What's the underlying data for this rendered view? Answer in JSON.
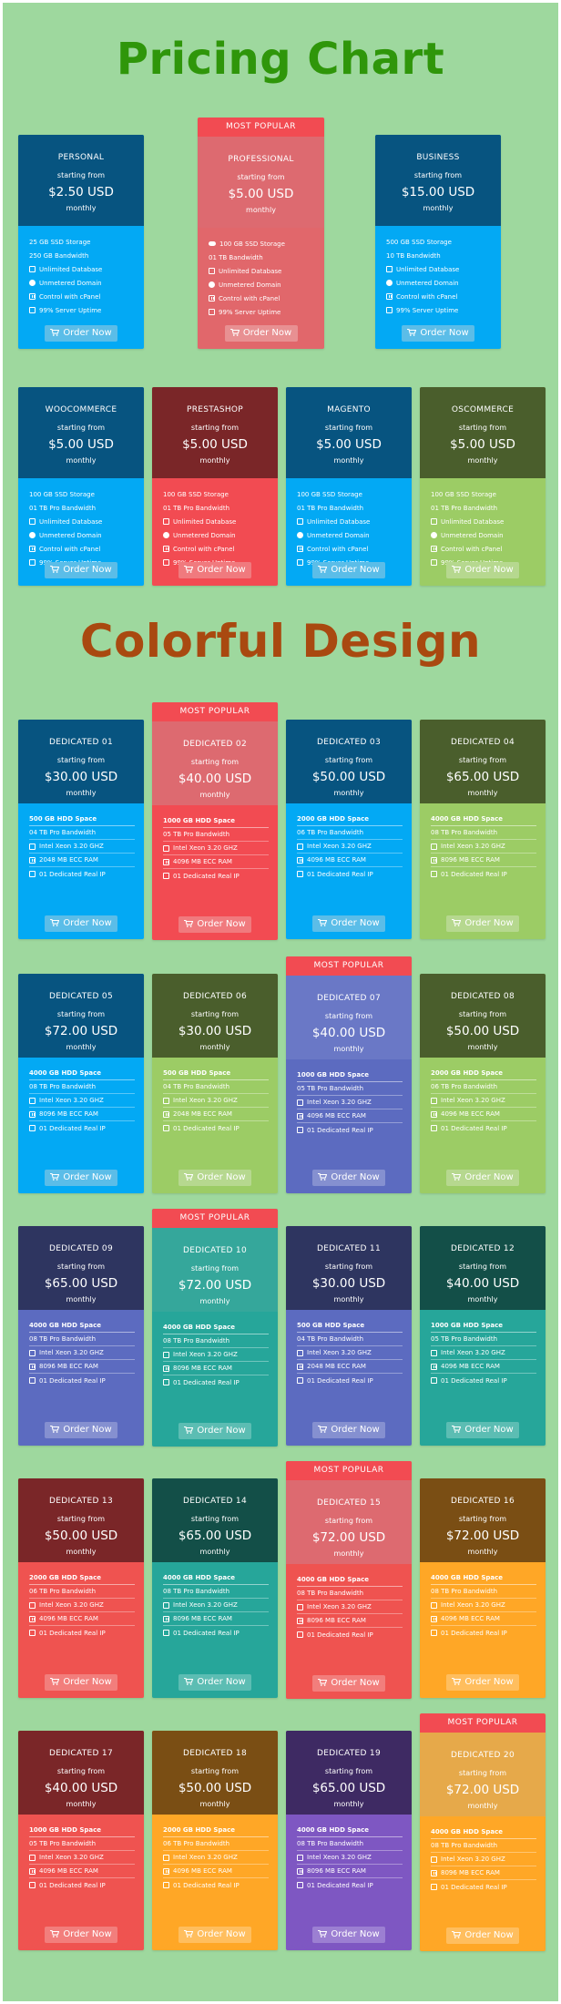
{
  "titles": {
    "pricing_chart": "Pricing Chart",
    "colorful_design": "Colorful Design"
  },
  "colors": {
    "page_bg": "#9ed89e",
    "title_green": "#2f960a",
    "title_orange": "#a94910",
    "most_popular_red": "#f24b52"
  },
  "common": {
    "starting_from": "starting from",
    "monthly": "monthly",
    "order_label": "Order Now",
    "most_popular": "MOST POPULAR"
  },
  "cards": [
    {
      "id": "personal",
      "name": "PERSONAL",
      "price": "$2.50 USD",
      "popular": false,
      "top_color": "#075480",
      "bottom_color": "#03a9f4",
      "button_color": "#5bbde8",
      "features": [
        {
          "icon": "none",
          "text": "25 GB SSD Storage"
        },
        {
          "icon": "none",
          "text": "250 GB Bandwidth"
        },
        {
          "icon": "database-icon",
          "text": "Unlimited Database"
        },
        {
          "icon": "globe-icon",
          "text": "Unmetered Domain"
        },
        {
          "icon": "cpanel-icon",
          "text": "Control with cPanel"
        },
        {
          "icon": "check-icon",
          "text": "99% Server Uptime"
        }
      ]
    },
    {
      "id": "professional",
      "name": "PROFESSIONAL",
      "price": "$5.00 USD",
      "popular": true,
      "top_color": "#dd6a70",
      "bottom_color": "#e1676b",
      "button_color": "#e89092",
      "features": [
        {
          "icon": "cloud-icon",
          "text": "100 GB SSD Storage"
        },
        {
          "icon": "none",
          "text": "01 TB Bandwidth"
        },
        {
          "icon": "database-icon",
          "text": "Unlimited Database"
        },
        {
          "icon": "globe-icon",
          "text": "Unmetered Domain"
        },
        {
          "icon": "cpanel-icon",
          "text": "Control with cPanel"
        },
        {
          "icon": "check-icon",
          "text": "99% Server Uptime"
        }
      ]
    },
    {
      "id": "business",
      "name": "BUSINESS",
      "price": "$15.00 USD",
      "popular": false,
      "top_color": "#075480",
      "bottom_color": "#03a9f4",
      "button_color": "#5bbde8",
      "features": [
        {
          "icon": "none",
          "text": "500 GB SSD Storage"
        },
        {
          "icon": "none",
          "text": "10 TB Bandwidth"
        },
        {
          "icon": "database-icon",
          "text": "Unlimited Database"
        },
        {
          "icon": "globe-icon",
          "text": "Unmetered Domain"
        },
        {
          "icon": "cpanel-icon",
          "text": "Control with cPanel"
        },
        {
          "icon": "check-icon",
          "text": "99% Server Uptime"
        }
      ]
    },
    {
      "id": "woocommerce",
      "name": "WOOCOMMERCE",
      "price": "$5.00 USD",
      "popular": false,
      "top_color": "#075480",
      "bottom_color": "#03a9f4",
      "button_color": "#5bbde8",
      "features": [
        {
          "icon": "none",
          "text": "100 GB SSD Storage"
        },
        {
          "icon": "none",
          "text": "01 TB Pro Bandwidth"
        },
        {
          "icon": "database-icon",
          "text": "Unlimited Database"
        },
        {
          "icon": "globe-icon",
          "text": "Unmetered Domain"
        },
        {
          "icon": "cpanel-icon",
          "text": "Control with cPanel"
        },
        {
          "icon": "check-icon",
          "text": "99% Server Uptime"
        }
      ]
    },
    {
      "id": "prestashop",
      "name": "PRESTASHOP",
      "price": "$5.00 USD",
      "popular": false,
      "top_color": "#7a2628",
      "bottom_color": "#f24b52",
      "button_color": "#f07a7e",
      "features": [
        {
          "icon": "none",
          "text": "100 GB SSD Storage"
        },
        {
          "icon": "none",
          "text": "01 TB Pro Bandwidth"
        },
        {
          "icon": "database-icon",
          "text": "Unlimited Database"
        },
        {
          "icon": "globe-icon",
          "text": "Unmetered Domain"
        },
        {
          "icon": "cpanel-icon",
          "text": "Control with cPanel"
        },
        {
          "icon": "check-icon",
          "text": "99% Server Uptime"
        }
      ]
    },
    {
      "id": "magento",
      "name": "MAGENTO",
      "price": "$5.00 USD",
      "popular": false,
      "top_color": "#075480",
      "bottom_color": "#03a9f4",
      "button_color": "#5bbde8",
      "features": [
        {
          "icon": "none",
          "text": "100 GB SSD Storage"
        },
        {
          "icon": "none",
          "text": "01 TB Pro Bandwidth"
        },
        {
          "icon": "database-icon",
          "text": "Unlimited Database"
        },
        {
          "icon": "globe-icon",
          "text": "Unmetered Domain"
        },
        {
          "icon": "cpanel-icon",
          "text": "Control with cPanel"
        },
        {
          "icon": "check-icon",
          "text": "99% Server Uptime"
        }
      ]
    },
    {
      "id": "oscommerce",
      "name": "OSCOMMERCE",
      "price": "$5.00 USD",
      "popular": false,
      "top_color": "#4a5e2c",
      "bottom_color": "#9ccc65",
      "button_color": "#b6d88f",
      "features": [
        {
          "icon": "none",
          "text": "100 GB SSD Storage"
        },
        {
          "icon": "none",
          "text": "01 TB Pro Bandwidth"
        },
        {
          "icon": "database-icon",
          "text": "Unlimited Database"
        },
        {
          "icon": "globe-icon",
          "text": "Unmetered Domain"
        },
        {
          "icon": "cpanel-icon",
          "text": "Control with cPanel"
        },
        {
          "icon": "check-icon",
          "text": "99% Server Uptime"
        }
      ]
    },
    {
      "id": "d01",
      "name": "DEDICATED 01",
      "price": "$30.00 USD",
      "popular": false,
      "top_color": "#075480",
      "bottom_color": "#03a9f4",
      "button_color": "#5bbde8",
      "features": [
        {
          "icon": "none",
          "text": "500 GB HDD Space"
        },
        {
          "icon": "none",
          "text": "04 TB Pro Bandwidth"
        },
        {
          "icon": "cpu-icon",
          "text": "Intel Xeon 3.20 GHZ"
        },
        {
          "icon": "ram-icon",
          "text": "2048 MB ECC RAM"
        },
        {
          "icon": "ip-icon",
          "text": "01 Dedicated Real IP"
        }
      ]
    },
    {
      "id": "d02",
      "name": "DEDICATED 02",
      "price": "$40.00 USD",
      "popular": true,
      "top_color": "#dd6a70",
      "bottom_color": "#f24b52",
      "button_color": "#f07a7e",
      "features": [
        {
          "icon": "none",
          "text": "1000 GB HDD Space"
        },
        {
          "icon": "none",
          "text": "05 TB Pro Bandwidth"
        },
        {
          "icon": "cpu-icon",
          "text": "Intel Xeon 3.20 GHZ"
        },
        {
          "icon": "ram-icon",
          "text": "4096 MB ECC RAM"
        },
        {
          "icon": "ip-icon",
          "text": "01 Dedicated Real IP"
        }
      ]
    },
    {
      "id": "d03",
      "name": "DEDICATED 03",
      "price": "$50.00 USD",
      "popular": false,
      "top_color": "#075480",
      "bottom_color": "#03a9f4",
      "button_color": "#5bbde8",
      "features": [
        {
          "icon": "none",
          "text": "2000 GB HDD Space"
        },
        {
          "icon": "none",
          "text": "06 TB Pro Bandwidth"
        },
        {
          "icon": "cpu-icon",
          "text": "Intel Xeon 3.20 GHZ"
        },
        {
          "icon": "ram-icon",
          "text": "4096 MB ECC RAM"
        },
        {
          "icon": "ip-icon",
          "text": "01 Dedicated Real IP"
        }
      ]
    },
    {
      "id": "d04",
      "name": "DEDICATED 04",
      "price": "$65.00 USD",
      "popular": false,
      "top_color": "#4a5e2c",
      "bottom_color": "#9ccc65",
      "button_color": "#b6d88f",
      "features": [
        {
          "icon": "none",
          "text": "4000 GB HDD Space"
        },
        {
          "icon": "none",
          "text": "08 TB Pro Bandwidth"
        },
        {
          "icon": "cpu-icon",
          "text": "Intel Xeon 3.20 GHZ"
        },
        {
          "icon": "ram-icon",
          "text": "8096 MB ECC RAM"
        },
        {
          "icon": "ip-icon",
          "text": "01 Dedicated Real IP"
        }
      ]
    },
    {
      "id": "d05",
      "name": "DEDICATED 05",
      "price": "$72.00 USD",
      "popular": false,
      "top_color": "#075480",
      "bottom_color": "#03a9f4",
      "button_color": "#5bbde8",
      "features": [
        {
          "icon": "none",
          "text": "4000 GB HDD Space"
        },
        {
          "icon": "none",
          "text": "08 TB Pro Bandwidth"
        },
        {
          "icon": "cpu-icon",
          "text": "Intel Xeon 3.20 GHZ"
        },
        {
          "icon": "ram-icon",
          "text": "8096 MB ECC RAM"
        },
        {
          "icon": "ip-icon",
          "text": "01 Dedicated Real IP"
        }
      ]
    },
    {
      "id": "d06",
      "name": "DEDICATED 06",
      "price": "$30.00 USD",
      "popular": false,
      "top_color": "#4a5e2c",
      "bottom_color": "#9ccc65",
      "button_color": "#b6d88f",
      "features": [
        {
          "icon": "none",
          "text": "500 GB HDD Space"
        },
        {
          "icon": "none",
          "text": "04 TB Pro Bandwidth"
        },
        {
          "icon": "cpu-icon",
          "text": "Intel Xeon 3.20 GHZ"
        },
        {
          "icon": "ram-icon",
          "text": "2048 MB ECC RAM"
        },
        {
          "icon": "ip-icon",
          "text": "01 Dedicated Real IP"
        }
      ]
    },
    {
      "id": "d07",
      "name": "DEDICATED 07",
      "price": "$40.00 USD",
      "popular": true,
      "top_color": "#6a78c6",
      "bottom_color": "#5c6bc0",
      "button_color": "#8590d0",
      "features": [
        {
          "icon": "none",
          "text": "1000 GB HDD Space"
        },
        {
          "icon": "none",
          "text": "05 TB Pro Bandwidth"
        },
        {
          "icon": "cpu-icon",
          "text": "Intel Xeon 3.20 GHZ"
        },
        {
          "icon": "ram-icon",
          "text": "4096 MB ECC RAM"
        },
        {
          "icon": "ip-icon",
          "text": "01 Dedicated Real IP"
        }
      ]
    },
    {
      "id": "d08",
      "name": "DEDICATED 08",
      "price": "$50.00 USD",
      "popular": false,
      "top_color": "#4a5e2c",
      "bottom_color": "#9ccc65",
      "button_color": "#b6d88f",
      "features": [
        {
          "icon": "none",
          "text": "2000 GB HDD Space"
        },
        {
          "icon": "none",
          "text": "06 TB Pro Bandwidth"
        },
        {
          "icon": "cpu-icon",
          "text": "Intel Xeon 3.20 GHZ"
        },
        {
          "icon": "ram-icon",
          "text": "4096 MB ECC RAM"
        },
        {
          "icon": "ip-icon",
          "text": "01 Dedicated Real IP"
        }
      ]
    },
    {
      "id": "d09",
      "name": "DEDICATED 09",
      "price": "$65.00 USD",
      "popular": false,
      "top_color": "#2e3560",
      "bottom_color": "#5c6bc0",
      "button_color": "#8590d0",
      "features": [
        {
          "icon": "none",
          "text": "4000 GB HDD Space"
        },
        {
          "icon": "none",
          "text": "08 TB Pro Bandwidth"
        },
        {
          "icon": "cpu-icon",
          "text": "Intel Xeon 3.20 GHZ"
        },
        {
          "icon": "ram-icon",
          "text": "8096 MB ECC RAM"
        },
        {
          "icon": "ip-icon",
          "text": "01 Dedicated Real IP"
        }
      ]
    },
    {
      "id": "d10",
      "name": "DEDICATED 10",
      "price": "$72.00 USD",
      "popular": true,
      "top_color": "#35a79b",
      "bottom_color": "#26a69a",
      "button_color": "#5cbdb3",
      "features": [
        {
          "icon": "none",
          "text": "4000 GB HDD Space"
        },
        {
          "icon": "none",
          "text": "08 TB Pro Bandwidth"
        },
        {
          "icon": "cpu-icon",
          "text": "Intel Xeon 3.20 GHZ"
        },
        {
          "icon": "ram-icon",
          "text": "8096 MB ECC RAM"
        },
        {
          "icon": "ip-icon",
          "text": "01 Dedicated Real IP"
        }
      ]
    },
    {
      "id": "d11",
      "name": "DEDICATED 11",
      "price": "$30.00 USD",
      "popular": false,
      "top_color": "#2e3560",
      "bottom_color": "#5c6bc0",
      "button_color": "#8590d0",
      "features": [
        {
          "icon": "none",
          "text": "500 GB HDD Space"
        },
        {
          "icon": "none",
          "text": "04 TB Pro Bandwidth"
        },
        {
          "icon": "cpu-icon",
          "text": "Intel Xeon 3.20 GHZ"
        },
        {
          "icon": "ram-icon",
          "text": "2048 MB ECC RAM"
        },
        {
          "icon": "ip-icon",
          "text": "01 Dedicated Real IP"
        }
      ]
    },
    {
      "id": "d12",
      "name": "DEDICATED 12",
      "price": "$40.00 USD",
      "popular": false,
      "top_color": "#134f48",
      "bottom_color": "#26a69a",
      "button_color": "#5cbdb3",
      "features": [
        {
          "icon": "none",
          "text": "1000 GB HDD Space"
        },
        {
          "icon": "none",
          "text": "05 TB Pro Bandwidth"
        },
        {
          "icon": "cpu-icon",
          "text": "Intel Xeon 3.20 GHZ"
        },
        {
          "icon": "ram-icon",
          "text": "4096 MB ECC RAM"
        },
        {
          "icon": "ip-icon",
          "text": "01 Dedicated Real IP"
        }
      ]
    },
    {
      "id": "d13",
      "name": "DEDICATED 13",
      "price": "$50.00 USD",
      "popular": false,
      "top_color": "#7a2628",
      "bottom_color": "#ef5350",
      "button_color": "#f27e7c",
      "features": [
        {
          "icon": "none",
          "text": "2000 GB HDD Space"
        },
        {
          "icon": "none",
          "text": "06 TB Pro Bandwidth"
        },
        {
          "icon": "cpu-icon",
          "text": "Intel Xeon 3.20 GHZ"
        },
        {
          "icon": "ram-icon",
          "text": "4096 MB ECC RAM"
        },
        {
          "icon": "ip-icon",
          "text": "01 Dedicated Real IP"
        }
      ]
    },
    {
      "id": "d14",
      "name": "DEDICATED 14",
      "price": "$65.00 USD",
      "popular": false,
      "top_color": "#134f48",
      "bottom_color": "#26a69a",
      "button_color": "#5cbdb3",
      "features": [
        {
          "icon": "none",
          "text": "4000 GB HDD Space"
        },
        {
          "icon": "none",
          "text": "08 TB Pro Bandwidth"
        },
        {
          "icon": "cpu-icon",
          "text": "Intel Xeon 3.20 GHZ"
        },
        {
          "icon": "ram-icon",
          "text": "8096 MB ECC RAM"
        },
        {
          "icon": "ip-icon",
          "text": "01 Dedicated Real IP"
        }
      ]
    },
    {
      "id": "d15",
      "name": "DEDICATED 15",
      "price": "$72.00 USD",
      "popular": true,
      "top_color": "#dd6a70",
      "bottom_color": "#ef5350",
      "button_color": "#f27e7c",
      "features": [
        {
          "icon": "none",
          "text": "4000 GB HDD Space"
        },
        {
          "icon": "none",
          "text": "08 TB Pro Bandwidth"
        },
        {
          "icon": "cpu-icon",
          "text": "Intel Xeon 3.20 GHZ"
        },
        {
          "icon": "ram-icon",
          "text": "8096 MB ECC RAM"
        },
        {
          "icon": "ip-icon",
          "text": "01 Dedicated Real IP"
        }
      ]
    },
    {
      "id": "d16",
      "name": "DEDICATED 16",
      "price": "$72.00 USD",
      "popular": false,
      "top_color": "#7a4e14",
      "bottom_color": "#ffa726",
      "button_color": "#ffbe5e",
      "features": [
        {
          "icon": "none",
          "text": "4000 GB HDD Space"
        },
        {
          "icon": "none",
          "text": "08 TB Pro Bandwidth"
        },
        {
          "icon": "cpu-icon",
          "text": "Intel Xeon 3.20 GHZ"
        },
        {
          "icon": "ram-icon",
          "text": "4096 MB ECC RAM"
        },
        {
          "icon": "ip-icon",
          "text": "01 Dedicated Real IP"
        }
      ]
    },
    {
      "id": "d17",
      "name": "DEDICATED 17",
      "price": "$40.00 USD",
      "popular": false,
      "top_color": "#7a2628",
      "bottom_color": "#ef5350",
      "button_color": "#f27e7c",
      "features": [
        {
          "icon": "none",
          "text": "1000 GB HDD Space"
        },
        {
          "icon": "none",
          "text": "05 TB Pro Bandwidth"
        },
        {
          "icon": "cpu-icon",
          "text": "Intel Xeon 3.20 GHZ"
        },
        {
          "icon": "ram-icon",
          "text": "4096 MB ECC RAM"
        },
        {
          "icon": "ip-icon",
          "text": "01 Dedicated Real IP"
        }
      ]
    },
    {
      "id": "d18",
      "name": "DEDICATED 18",
      "price": "$50.00 USD",
      "popular": false,
      "top_color": "#7a4e14",
      "bottom_color": "#ffa726",
      "button_color": "#ffbe5e",
      "features": [
        {
          "icon": "none",
          "text": "2000 GB HDD Space"
        },
        {
          "icon": "none",
          "text": "06 TB Pro Bandwidth"
        },
        {
          "icon": "cpu-icon",
          "text": "Intel Xeon 3.20 GHZ"
        },
        {
          "icon": "ram-icon",
          "text": "4096 MB ECC RAM"
        },
        {
          "icon": "ip-icon",
          "text": "01 Dedicated Real IP"
        }
      ]
    },
    {
      "id": "d19",
      "name": "DEDICATED 19",
      "price": "$65.00 USD",
      "popular": false,
      "top_color": "#3e2a63",
      "bottom_color": "#7e57c2",
      "button_color": "#9c7fd2",
      "features": [
        {
          "icon": "none",
          "text": "4000 GB HDD Space"
        },
        {
          "icon": "none",
          "text": "08 TB Pro Bandwidth"
        },
        {
          "icon": "cpu-icon",
          "text": "Intel Xeon 3.20 GHZ"
        },
        {
          "icon": "ram-icon",
          "text": "8096 MB ECC RAM"
        },
        {
          "icon": "ip-icon",
          "text": "01 Dedicated Real IP"
        }
      ]
    },
    {
      "id": "d20",
      "name": "DEDICATED 20",
      "price": "$72.00 USD",
      "popular": true,
      "top_color": "#e6a94a",
      "bottom_color": "#ffa726",
      "button_color": "#ffbe5e",
      "features": [
        {
          "icon": "none",
          "text": "4000 GB HDD Space"
        },
        {
          "icon": "none",
          "text": "08 TB Pro Bandwidth"
        },
        {
          "icon": "cpu-icon",
          "text": "Intel Xeon 3.20 GHZ"
        },
        {
          "icon": "ram-icon",
          "text": "8096 MB ECC RAM"
        },
        {
          "icon": "ip-icon",
          "text": "01 Dedicated Real IP"
        }
      ]
    }
  ]
}
